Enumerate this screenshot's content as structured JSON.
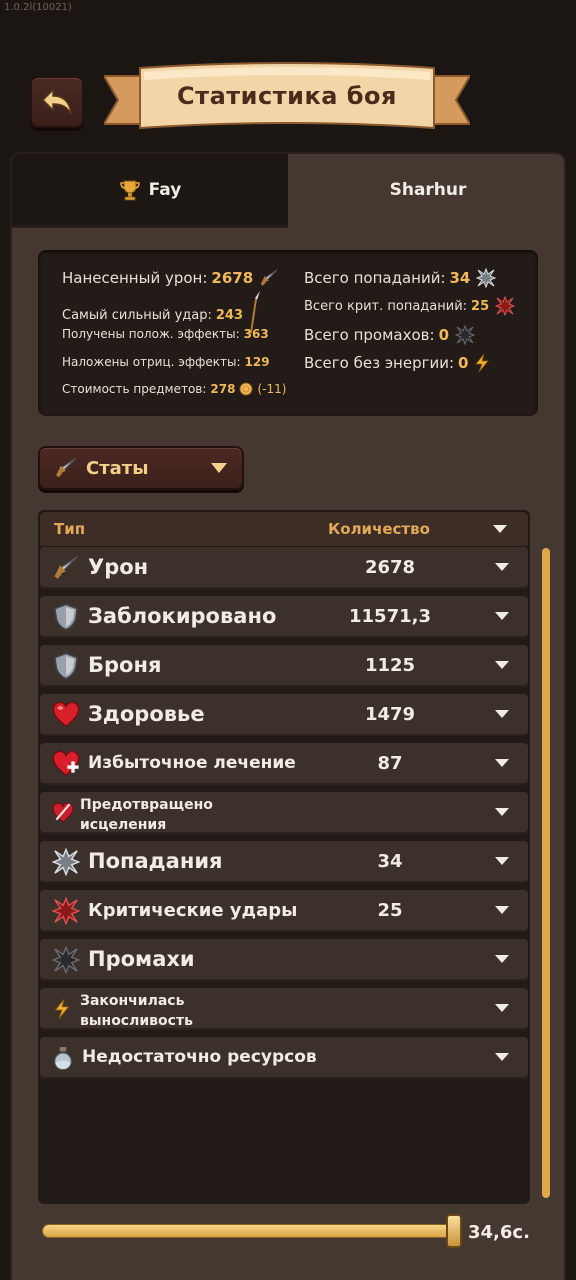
{
  "version": "1.0.2l(10021)",
  "header": {
    "title": "Статистика боя"
  },
  "tabs": [
    {
      "label": "Fay",
      "active": false,
      "icon": "trophy-icon"
    },
    {
      "label": "Sharhur",
      "active": true
    }
  ],
  "summary": {
    "damage_dealt": {
      "label": "Нанесенный урон:",
      "value": "2678"
    },
    "strongest_hit": {
      "label": "Самый сильный удар:",
      "value": "243"
    },
    "positive_effects": {
      "label": "Получены полож. эффекты:",
      "value": "363"
    },
    "negative_effects": {
      "label": "Наложены отриц. эффекты:",
      "value": "129"
    },
    "items_cost": {
      "label": "Стоимость предметов:",
      "value": "278",
      "delta": "(-11)"
    },
    "total_hits": {
      "label": "Всего попаданий:",
      "value": "34"
    },
    "total_crits": {
      "label": "Всего крит. попаданий:",
      "value": "25"
    },
    "total_misses": {
      "label": "Всего промахов:",
      "value": "0"
    },
    "total_no_energy": {
      "label": "Всего без энергии:",
      "value": "0"
    }
  },
  "filter": {
    "selected": "Статы"
  },
  "table": {
    "headers": {
      "type": "Тип",
      "amount": "Количество"
    },
    "rows": [
      {
        "label": "Урон",
        "value": "2678",
        "icon": "sword-icon"
      },
      {
        "label": "Заблокировано",
        "value": "11571,3",
        "icon": "shield-icon"
      },
      {
        "label": "Броня",
        "value": "1125",
        "icon": "shield-icon"
      },
      {
        "label": "Здоровье",
        "value": "1479",
        "icon": "heart-icon"
      },
      {
        "label": "Избыточное лечение",
        "value": "87",
        "icon": "heart-plus-icon"
      },
      {
        "label": "Предотвращено исцеления",
        "value": "",
        "icon": "broken-heart-icon"
      },
      {
        "label": "Попадания",
        "value": "34",
        "icon": "hit-icon"
      },
      {
        "label": "Критические удары",
        "value": "25",
        "icon": "crit-icon"
      },
      {
        "label": "Промахи",
        "value": "",
        "icon": "miss-icon"
      },
      {
        "label": "Закончилась выносливость",
        "value": "",
        "icon": "lightning-icon"
      },
      {
        "label": "Недостаточно ресурсов",
        "value": "",
        "icon": "potion-icon"
      }
    ]
  },
  "timeline": {
    "time_label": "34,6с.",
    "position": 1.0
  },
  "colors": {
    "accent": "#f0b85a",
    "panel": "#453830",
    "row": "#3b302a"
  }
}
